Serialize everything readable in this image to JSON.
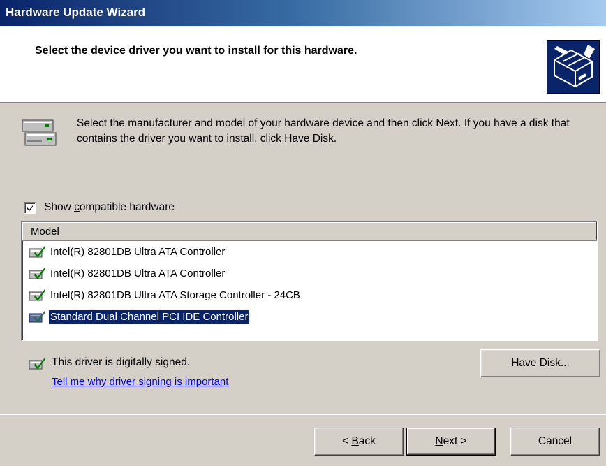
{
  "window": {
    "title": "Hardware Update Wizard"
  },
  "header": {
    "title": "Select the device driver you want to install for this hardware.",
    "icon": "hardware-install-icon"
  },
  "intro": {
    "icon": "hardware-devices-icon",
    "text": "Select the manufacturer and model of your hardware device and then click Next. If you have a disk that contains the driver you want to install, click Have Disk."
  },
  "compatible": {
    "checked": true,
    "label_pre": "Show ",
    "label_accel": "c",
    "label_post": "ompatible hardware"
  },
  "model_list": {
    "column_header": "Model",
    "items": [
      {
        "label": "Intel(R) 82801DB Ultra ATA Controller",
        "icon": "signed-driver-icon",
        "selected": false
      },
      {
        "label": "Intel(R) 82801DB Ultra ATA Controller",
        "icon": "signed-driver-icon",
        "selected": false
      },
      {
        "label": "Intel(R) 82801DB Ultra ATA Storage Controller - 24CB",
        "icon": "signed-driver-icon",
        "selected": false
      },
      {
        "label": "Standard Dual Channel PCI IDE Controller",
        "icon": "signed-driver-icon",
        "selected": true
      }
    ]
  },
  "signing": {
    "icon": "signed-driver-icon",
    "text": "This driver is digitally signed.",
    "link": "Tell me why driver signing is important"
  },
  "buttons": {
    "have_disk_accel": "H",
    "have_disk_rest": "ave Disk...",
    "back_prefix": "< ",
    "back_accel": "B",
    "back_rest": "ack",
    "next_accel": "N",
    "next_rest": "ext >",
    "cancel": "Cancel"
  },
  "colors": {
    "dialog_bg": "#d4d0c8",
    "selection": "#0a246a",
    "link": "#0000ff"
  }
}
